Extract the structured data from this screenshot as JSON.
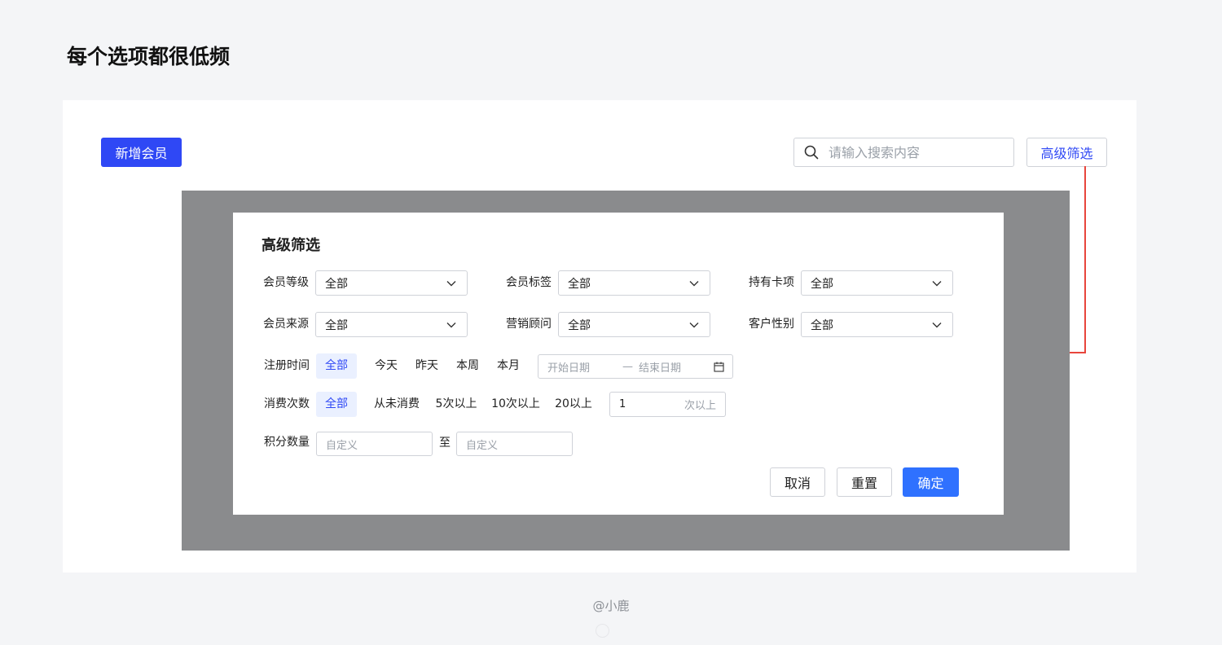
{
  "page": {
    "title": "每个选项都很低频"
  },
  "toolbar": {
    "add_member_label": "新增会员",
    "search_placeholder": "请输入搜索内容",
    "advanced_filter_label": "高级筛选"
  },
  "modal": {
    "title": "高级筛选",
    "selects": [
      {
        "label": "会员等级",
        "value": "全部"
      },
      {
        "label": "会员标签",
        "value": "全部"
      },
      {
        "label": "持有卡项",
        "value": "全部"
      },
      {
        "label": "会员来源",
        "value": "全部"
      },
      {
        "label": "营销顾问",
        "value": "全部"
      },
      {
        "label": "客户性别",
        "value": "全部"
      }
    ],
    "register_time": {
      "label": "注册时间",
      "options": [
        "全部",
        "今天",
        "昨天",
        "本周",
        "本月"
      ],
      "selected": "全部",
      "start_placeholder": "开始日期",
      "separator": "—",
      "end_placeholder": "结束日期"
    },
    "consume_count": {
      "label": "消费次数",
      "options": [
        "全部",
        "从未消费",
        "5次以上",
        "10次以上",
        "20以上"
      ],
      "selected": "全部",
      "custom_value": "1",
      "custom_suffix": "次以上"
    },
    "points": {
      "label": "积分数量",
      "min_placeholder": "自定义",
      "to_label": "至",
      "max_placeholder": "自定义"
    },
    "actions": {
      "cancel": "取消",
      "reset": "重置",
      "confirm": "确定"
    }
  },
  "colors": {
    "primary": "#2f48f5",
    "confirm": "#2f71ff",
    "arrow": "#e8453c",
    "overlay": "#8a8b8d"
  },
  "watermark": "@小鹿"
}
